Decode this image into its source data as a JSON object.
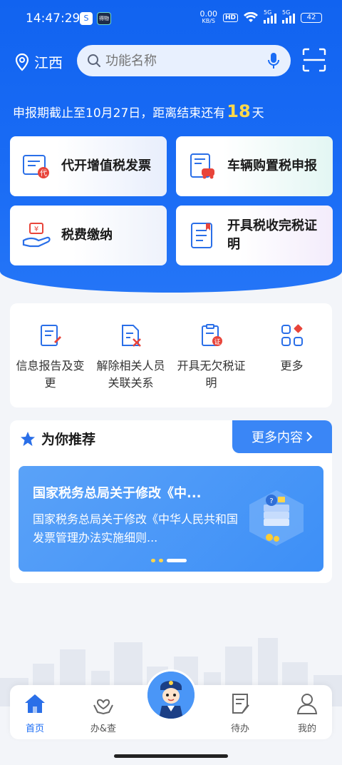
{
  "status_bar": {
    "time": "14:47:29",
    "app1": "S",
    "app2": "得物",
    "speed": "0.00",
    "speed_unit": "KB/S",
    "hd": "HD",
    "net1": "5G",
    "net2": "5G",
    "battery": "42"
  },
  "header": {
    "location": "江西",
    "search_placeholder": "功能名称"
  },
  "deadline": {
    "prefix": "申报期截止至10月27日，距离结束还有",
    "days": "18",
    "suffix": "天"
  },
  "quick_cards": [
    {
      "label": "代开增值税发票",
      "icon": "invoice-icon"
    },
    {
      "label": "车辆购置税申报",
      "icon": "vehicle-tax-icon"
    },
    {
      "label": "税费缴纳",
      "icon": "payment-icon"
    },
    {
      "label": "开具税收完税证明",
      "icon": "certificate-icon"
    }
  ],
  "services": [
    {
      "label": "信息报告及变更",
      "icon": "report-icon"
    },
    {
      "label": "解除相关人员关联关系",
      "icon": "unlink-icon"
    },
    {
      "label": "开具无欠税证明",
      "icon": "no-arrears-icon"
    },
    {
      "label": "更多",
      "icon": "more-grid-icon"
    }
  ],
  "recommend": {
    "title": "为你推荐",
    "more": "更多内容",
    "banner_title": "国家税务总局关于修改《中...",
    "banner_desc": "国家税务总局关于修改《中华人民共和国发票管理办法实施细则..."
  },
  "tabs": [
    {
      "label": "首页",
      "icon": "home-icon",
      "active": true
    },
    {
      "label": "办&查",
      "icon": "heart-hands-icon",
      "active": false
    },
    {
      "label": "待办",
      "icon": "todo-icon",
      "active": false
    },
    {
      "label": "我的",
      "icon": "person-icon",
      "active": false
    }
  ],
  "colors": {
    "primary": "#1a6cf5",
    "highlight": "#ffd84a",
    "accent_red": "#e8443a"
  }
}
